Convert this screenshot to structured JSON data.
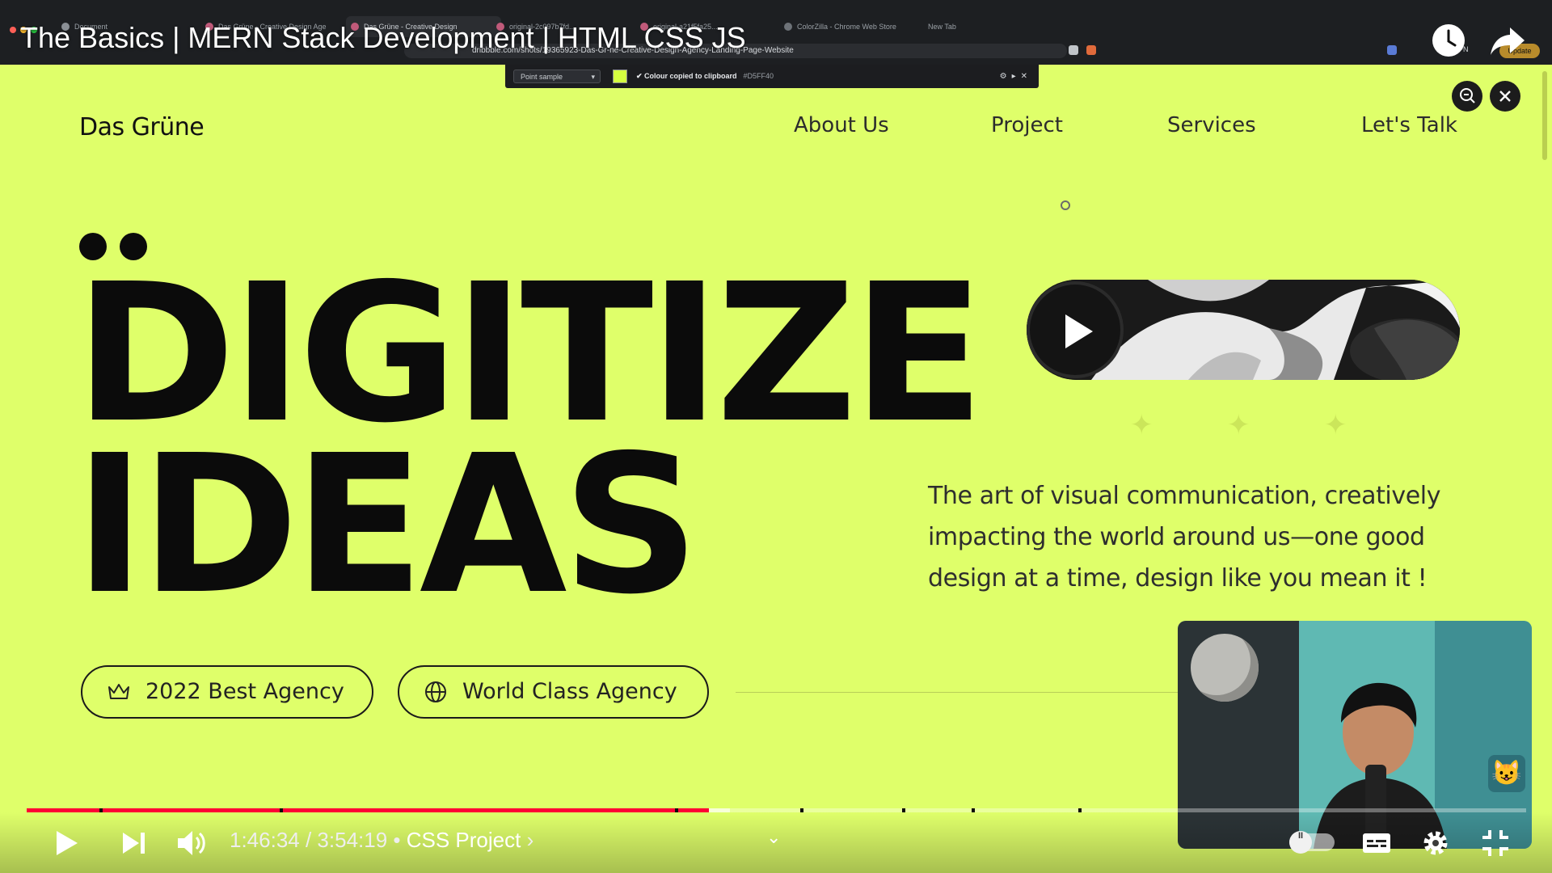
{
  "video": {
    "title": "The Basics | MERN Stack Development | HTML CSS JS"
  },
  "browser": {
    "tabs": [
      {
        "label": "Document"
      },
      {
        "label": "Das Grüne - Creative Design Age"
      },
      {
        "label": "Das Grüne - Creative Design"
      },
      {
        "label": "original-2c097b7fd..."
      },
      {
        "label": "original-a21f5fa25..."
      },
      {
        "label": "ColorZilla - Chrome Web Store"
      },
      {
        "label": "New Tab"
      }
    ],
    "url": "dribbble.com/shots/19365923-Das-Gr-ne-Creative-Design-Agency-Landing-Page-Website",
    "vpn_label": "VPN",
    "update_label": "Update"
  },
  "colorzilla": {
    "mode": "Point sample",
    "message": "Colour copied to clipboard",
    "hex": "#D5FF40"
  },
  "site": {
    "brand": "Das Grüne",
    "nav": [
      "About Us",
      "Project",
      "Services",
      "Let's Talk"
    ],
    "headline_line1": "DIGITIZE",
    "headline_line2": "IDEAS",
    "tagline": "The art of visual communication, creatively impacting the world around us—one good design at a time, design like you mean it !",
    "chips": [
      "2022 Best Agency",
      "World Class Agency"
    ],
    "colors": {
      "background": "#DFFF6A",
      "ink": "#0B0B0B"
    }
  },
  "player": {
    "current_time": "1:46:34",
    "duration": "3:54:19",
    "chapter": "CSS Project",
    "separator": " / ",
    "bullet": " • ",
    "progress_fraction": 0.455,
    "accent": "#FF0033",
    "autoplay_knob": "II"
  }
}
